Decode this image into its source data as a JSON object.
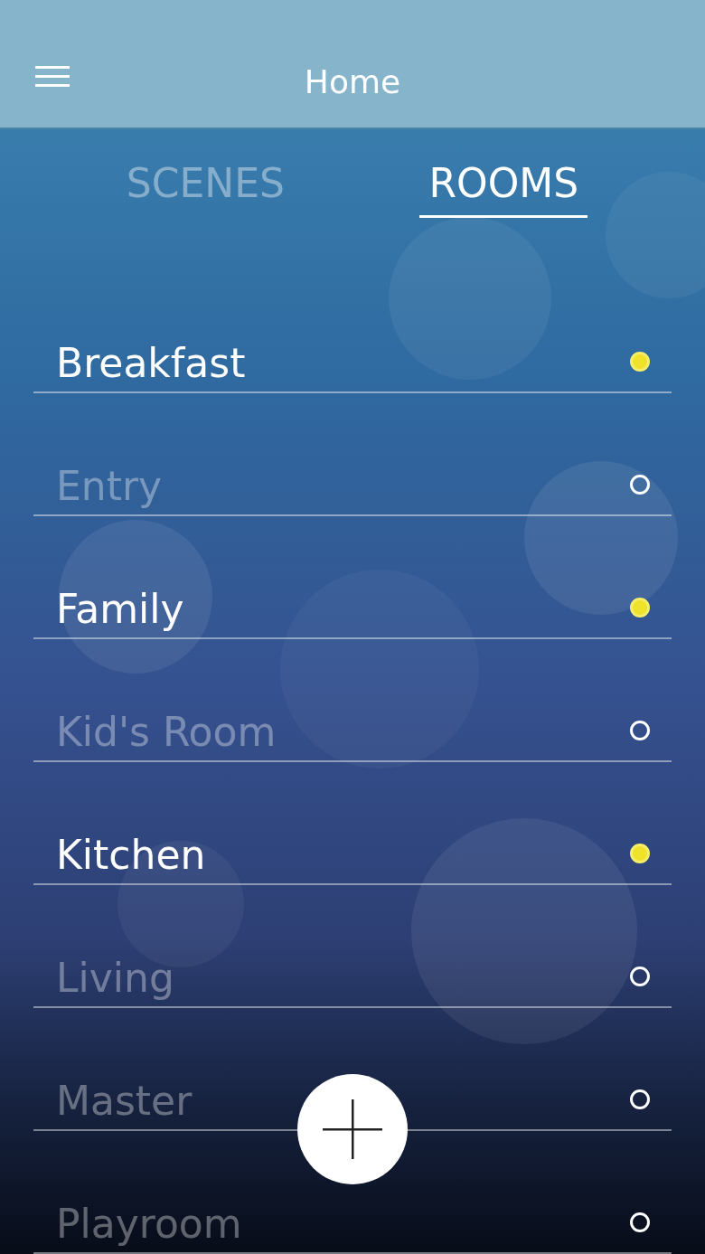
{
  "header": {
    "title": "Home"
  },
  "tabs": [
    {
      "label": "SCENES",
      "selected": false
    },
    {
      "label": "ROOMS",
      "selected": true
    }
  ],
  "rooms": [
    {
      "name": "Breakfast",
      "on": true
    },
    {
      "name": "Entry",
      "on": false
    },
    {
      "name": "Family",
      "on": true
    },
    {
      "name": "Kid's Room",
      "on": false
    },
    {
      "name": "Kitchen",
      "on": true
    },
    {
      "name": "Living",
      "on": false
    },
    {
      "name": "Master",
      "on": false
    },
    {
      "name": "Playroom",
      "on": false
    }
  ]
}
